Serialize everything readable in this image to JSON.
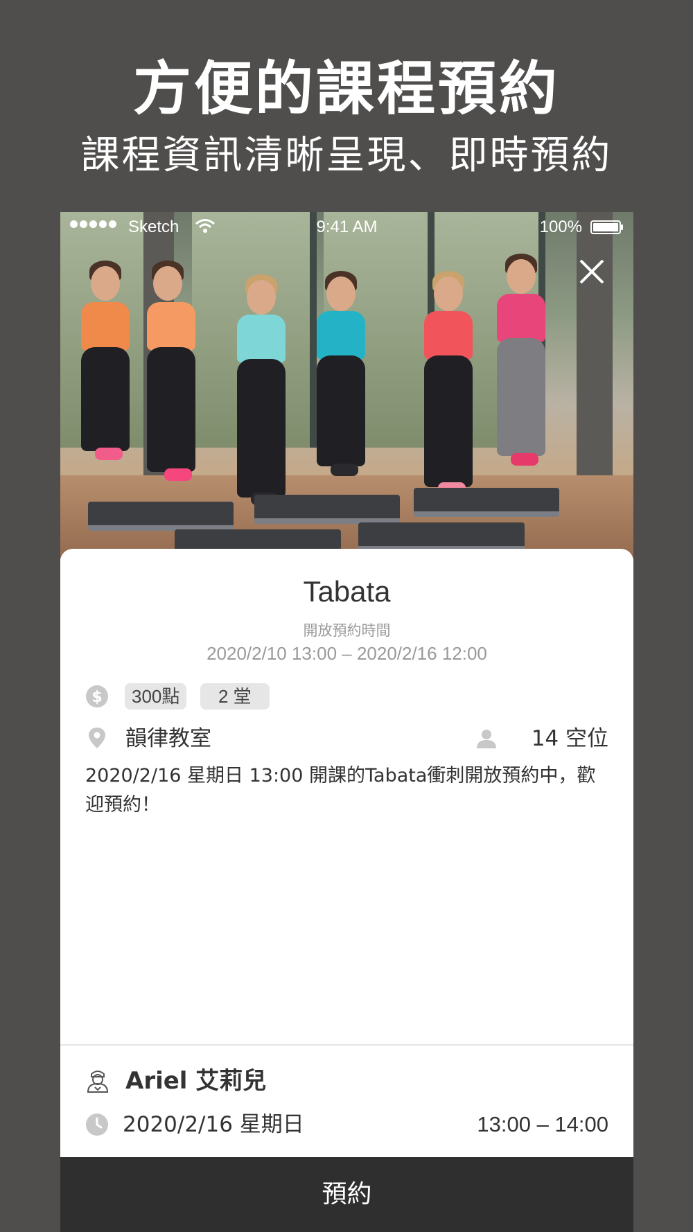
{
  "promo": {
    "title": "方便的課程預約",
    "subtitle": "課程資訊清晰呈現、即時預約"
  },
  "status_bar": {
    "carrier": "Sketch",
    "time": "9:41 AM",
    "battery": "100%"
  },
  "course": {
    "title": "Tabata",
    "booking_period_label": "開放預約時間",
    "booking_period_range": "2020/2/10 13:00 – 2020/2/16 12:00",
    "points": "300點",
    "sessions": "2 堂",
    "location": "韻律教室",
    "seats": "14 空位",
    "description": "2020/2/16  星期日  13:00  開課的Tabata衝刺開放預約中，歡迎預約！"
  },
  "instructor": {
    "name": "Ariel 艾莉兒"
  },
  "schedule": {
    "date": "2020/2/16 星期日",
    "time": "13:00 – 14:00"
  },
  "actions": {
    "book_label": "預約"
  },
  "icons": {
    "close": "close-icon",
    "price": "dollar-icon",
    "location": "location-pin-icon",
    "seats": "person-icon",
    "instructor": "instructor-icon",
    "clock": "clock-icon"
  },
  "colors": {
    "background": "#504e4d",
    "book_button": "#2f2f2f",
    "chip": "#e6e6e6",
    "icon_gray": "#c8c8c8",
    "muted_text": "#9a9a9a"
  }
}
